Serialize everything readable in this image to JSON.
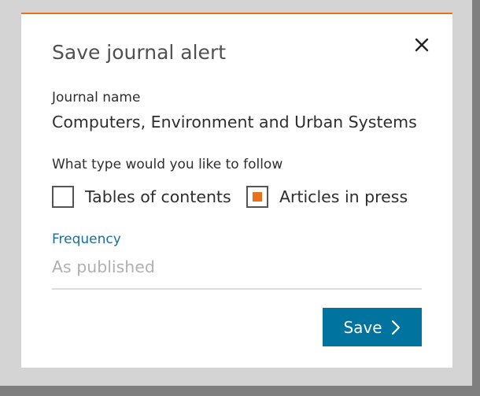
{
  "dialog": {
    "title": "Save journal alert",
    "close_icon": "close-icon",
    "accent_color": "#e9711c"
  },
  "journal": {
    "label": "Journal name",
    "value": "Computers, Environment and Urban Systems"
  },
  "follow": {
    "label": "What type would you like to follow",
    "options": [
      {
        "label": "Tables of contents",
        "checked": false
      },
      {
        "label": "Articles in press",
        "checked": true
      }
    ]
  },
  "frequency": {
    "label": "Frequency",
    "value": "As published"
  },
  "actions": {
    "save_label": "Save",
    "save_icon": "chevron-right-icon",
    "button_color": "#00739e"
  }
}
